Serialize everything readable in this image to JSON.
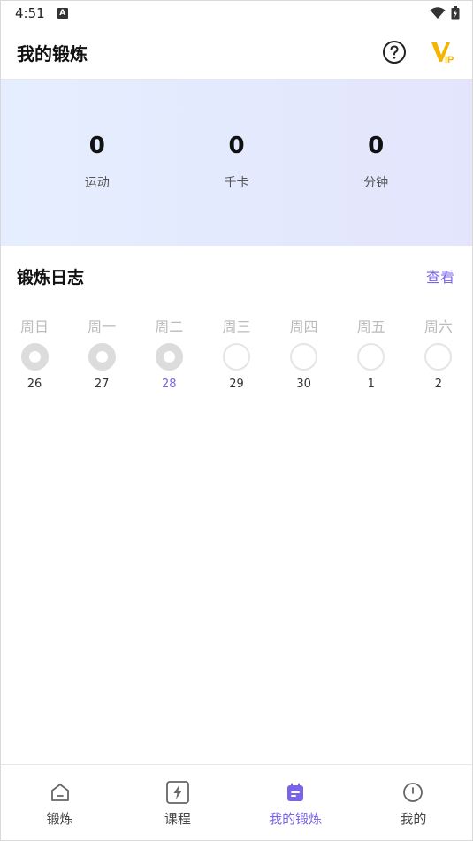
{
  "status_bar": {
    "time": "4:51",
    "indicator": "A"
  },
  "header": {
    "title": "我的锻炼",
    "help_icon": "question-circle-icon",
    "vip_icon": "vip-badge-icon",
    "vip_text": "IP"
  },
  "stats": [
    {
      "value": "0",
      "label": "运动"
    },
    {
      "value": "0",
      "label": "千卡"
    },
    {
      "value": "0",
      "label": "分钟"
    }
  ],
  "log": {
    "title": "锻炼日志",
    "view_label": "查看",
    "days": [
      {
        "name": "周日",
        "date": "26",
        "done": true,
        "today": false
      },
      {
        "name": "周一",
        "date": "27",
        "done": true,
        "today": false
      },
      {
        "name": "周二",
        "date": "28",
        "done": true,
        "today": true
      },
      {
        "name": "周三",
        "date": "29",
        "done": false,
        "today": false
      },
      {
        "name": "周四",
        "date": "30",
        "done": false,
        "today": false
      },
      {
        "name": "周五",
        "date": "1",
        "done": false,
        "today": false
      },
      {
        "name": "周六",
        "date": "2",
        "done": false,
        "today": false
      }
    ]
  },
  "tabs": [
    {
      "label": "锻炼",
      "icon": "home-icon",
      "active": false
    },
    {
      "label": "课程",
      "icon": "lightning-icon",
      "active": false
    },
    {
      "label": "我的锻炼",
      "icon": "calendar-icon",
      "active": true
    },
    {
      "label": "我的",
      "icon": "profile-icon",
      "active": false
    }
  ],
  "colors": {
    "accent": "#7a63e6",
    "vip": "#f4b400"
  }
}
